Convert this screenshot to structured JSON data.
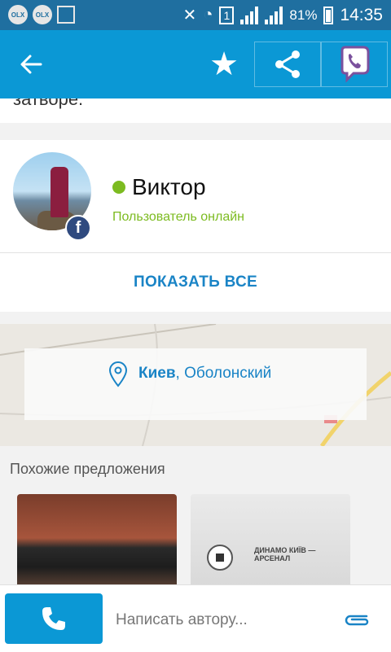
{
  "status_bar": {
    "notif_icons": [
      "olx-icon",
      "olx-icon",
      "image-icon"
    ],
    "sim_number": "1",
    "battery_percent": "81%",
    "time": "14:35"
  },
  "app_bar": {
    "back_icon": "arrow-left-icon",
    "favorite_icon": "star-icon",
    "share_icon": "share-icon",
    "viber_icon": "viber-icon"
  },
  "description": {
    "cut_text": "затворе."
  },
  "user": {
    "name": "Виктор",
    "status": "Пользователь онлайн",
    "status_color": "#7cbb20",
    "social_badge": "f"
  },
  "show_all": {
    "label": "ПОКАЗАТЬ ВСЕ"
  },
  "location": {
    "city": "Киев",
    "district": ", Оболонский"
  },
  "similar": {
    "title": "Похожие предложения",
    "ticket_text": "ДИНАМО КИЇВ — АРСЕНАЛ"
  },
  "bottom": {
    "message_placeholder": "Написать автору...",
    "call_icon": "phone-icon",
    "attach_icon": "paperclip-icon"
  },
  "colors": {
    "accent": "#0b98d5",
    "status_bar": "#1f6fa0",
    "link": "#1a84c6"
  }
}
